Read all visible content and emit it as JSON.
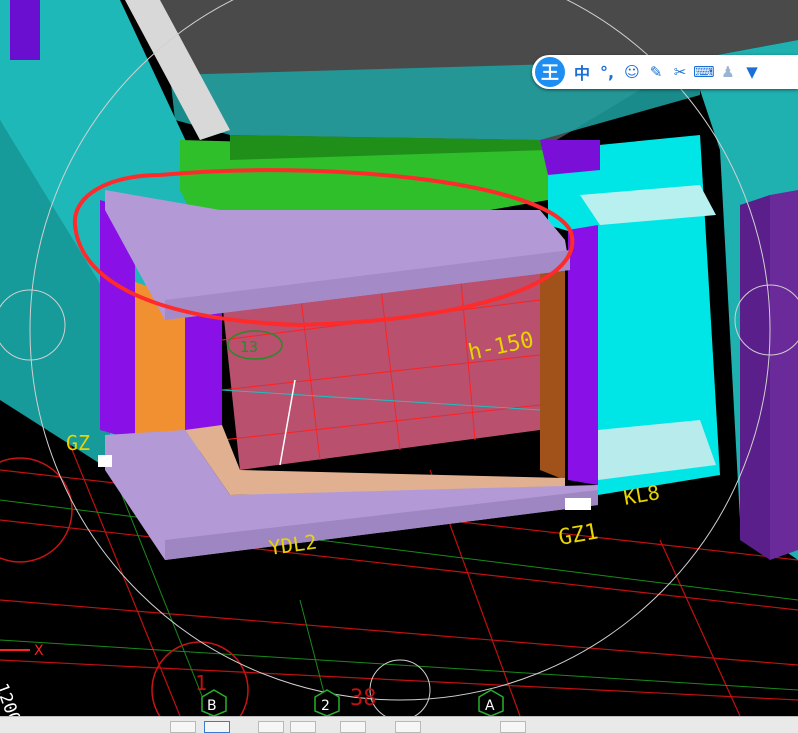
{
  "viewport": {
    "labels": {
      "h_note": "h-150",
      "room_tag": "13",
      "col_gz_left": "GZ",
      "col_gz1": "GZ1",
      "beam_kl": "KL8",
      "beam_ydl": "YDL2",
      "dim_1200": "1200",
      "dim_38": "38",
      "dim_1": "1",
      "axis_x": "X"
    },
    "axis_markers": [
      "B",
      "2",
      "A"
    ]
  },
  "ime_toolbar": {
    "logo": "王",
    "mode": "中",
    "punct": "°,",
    "icons": [
      "emoji-icon",
      "pen-icon",
      "scissors-icon",
      "keyboard-icon",
      "user-icon",
      "shirt-icon"
    ]
  },
  "colors": {
    "background": "#000000",
    "slab_purple": "#b39ad6",
    "wall_cyan": "#00e6e6",
    "column_violet": "#8a10e8",
    "beam_green": "#2fbf2a",
    "floor_pink": "#b8506e",
    "grid_red": "#e01010",
    "annotation_red": "#ff2a2a"
  }
}
